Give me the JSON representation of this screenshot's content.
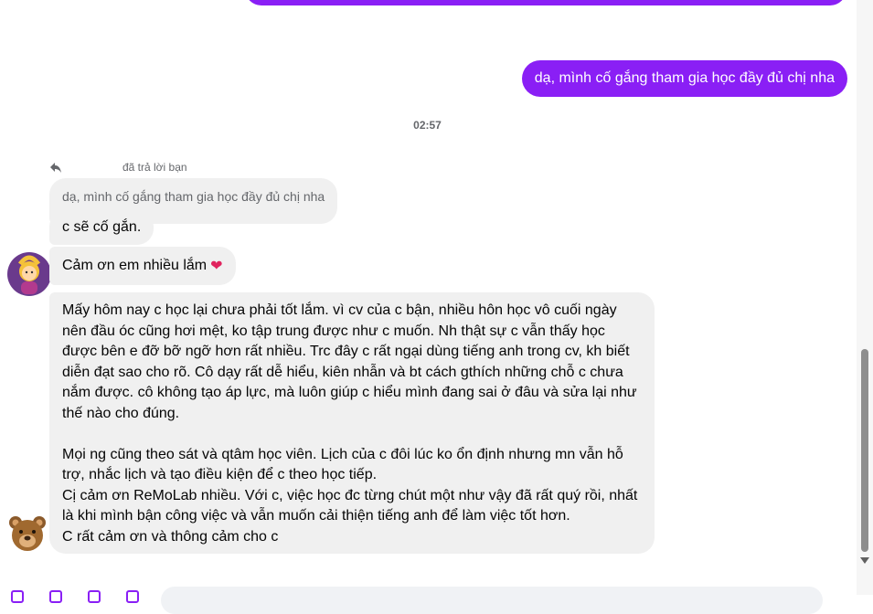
{
  "messages": {
    "outgoing_text": "dạ, mình cố gắng tham gia học đầy đủ chị nha",
    "timestamp": "02:57",
    "reply_meta": "đã trả lời bạn",
    "quoted_text": "dạ, mình cố gắng tham gia học đầy đủ chị nha",
    "reply_text": "c sẽ cố gắn.",
    "thanks_text": "Cảm ơn em nhiều lắm",
    "thanks_emoji": "❤",
    "long_text": "Mấy hôm nay c học lại chưa phải tốt lắm. vì cv của c bận, nhiều hôn học vô cuối ngày nên đầu óc cũng hơi mệt, ko tập trung được như c muốn. Nh thật sự c vẫn thấy học được bên e đỡ bỡ ngỡ hơn rất nhiều. Trc đây c rất ngại dùng tiếng anh trong cv, kh biết diễn đạt sao cho rõ. Cô dạy rất dễ hiểu, kiên nhẫn và bt cách gthích những chỗ c chưa nắm được. cô không tạo áp lực, mà luôn giúp c hiểu mình đang sai ở đâu và sửa lại như thế nào cho đúng.\n\nMọi ng cũng theo sát và qtâm học viên. Lịch của c đôi lúc ko ổn định nhưng mn vẫn hỗ trợ, nhắc lịch và tạo điều kiện để c theo học tiếp.\nCị cảm ơn ReMoLab nhiều. Với c, việc học đc từng chút một như vậy đã rất quý rồi, nhất là khi mình bận công việc và vẫn muốn cải thiện tiếng anh để làm việc tốt hơn.\nC rất cảm ơn và thông cảm cho c"
  },
  "icons": {
    "reply": "reply-arrow-icon",
    "avatar_1": "woman-gesturing-ok-avatar",
    "avatar_2": "bear-avatar"
  },
  "colors": {
    "outgoing_bubble": "#8a1ff5",
    "incoming_bubble": "#f0f0f0",
    "meta_text": "#65676b",
    "heart": "#e0245e"
  }
}
